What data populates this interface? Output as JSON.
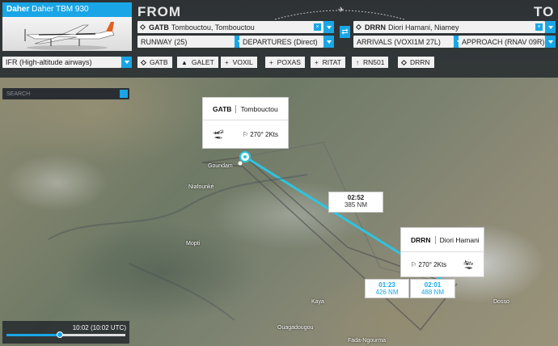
{
  "aircraft": {
    "brand": "Daher",
    "model": "Daher TBM 930"
  },
  "from": {
    "label": "FROM",
    "airport_code": "GATB",
    "airport_name": "Tombouctou, Tombouctou",
    "runway": "RUNWAY (25)",
    "departure": "DEPARTURES (Direct)"
  },
  "to": {
    "label": "TO",
    "airport_code": "DRRN",
    "airport_name": "Diori Hamani, Niamey",
    "arrival": "ARRIVALS (VOXI1M 27L)",
    "approach": "APPROACH (RNAV 09R)"
  },
  "flight_type": "IFR (High-altitude airways)",
  "waypoints": [
    {
      "icon": "diamond",
      "name": "GATB"
    },
    {
      "icon": "triangle",
      "name": "GALET"
    },
    {
      "icon": "cross",
      "name": "VOXIL"
    },
    {
      "icon": "cross",
      "name": "POXAS"
    },
    {
      "icon": "cross",
      "name": "RITAT"
    },
    {
      "icon": "ndb",
      "name": "RN501"
    },
    {
      "icon": "diamond",
      "name": "DRRN"
    }
  ],
  "search": {
    "placeholder": "SEARCH"
  },
  "departure_callout": {
    "code": "GATB",
    "name": "Tombouctou",
    "wind": "270° 2Kts"
  },
  "arrival_callout": {
    "code": "DRRN",
    "name": "Diori Hamani",
    "wind": "270° 2Kts"
  },
  "leg_main": {
    "time": "02:52",
    "distance": "385 NM"
  },
  "leg_alt1": {
    "time": "01:23",
    "distance": "426 NM"
  },
  "leg_alt2": {
    "time": "02:01",
    "distance": "488 NM"
  },
  "towns": [
    "Goundam",
    "Niafounké",
    "Mopti",
    "Kaya",
    "Ouagadougou",
    "Fada-Ngourma",
    "Dosso"
  ],
  "time": {
    "display": "10:02 (10:02 UTC)",
    "progress": 0.45
  },
  "colors": {
    "accent": "#1aa6e6",
    "route": "#2ec4e0"
  }
}
